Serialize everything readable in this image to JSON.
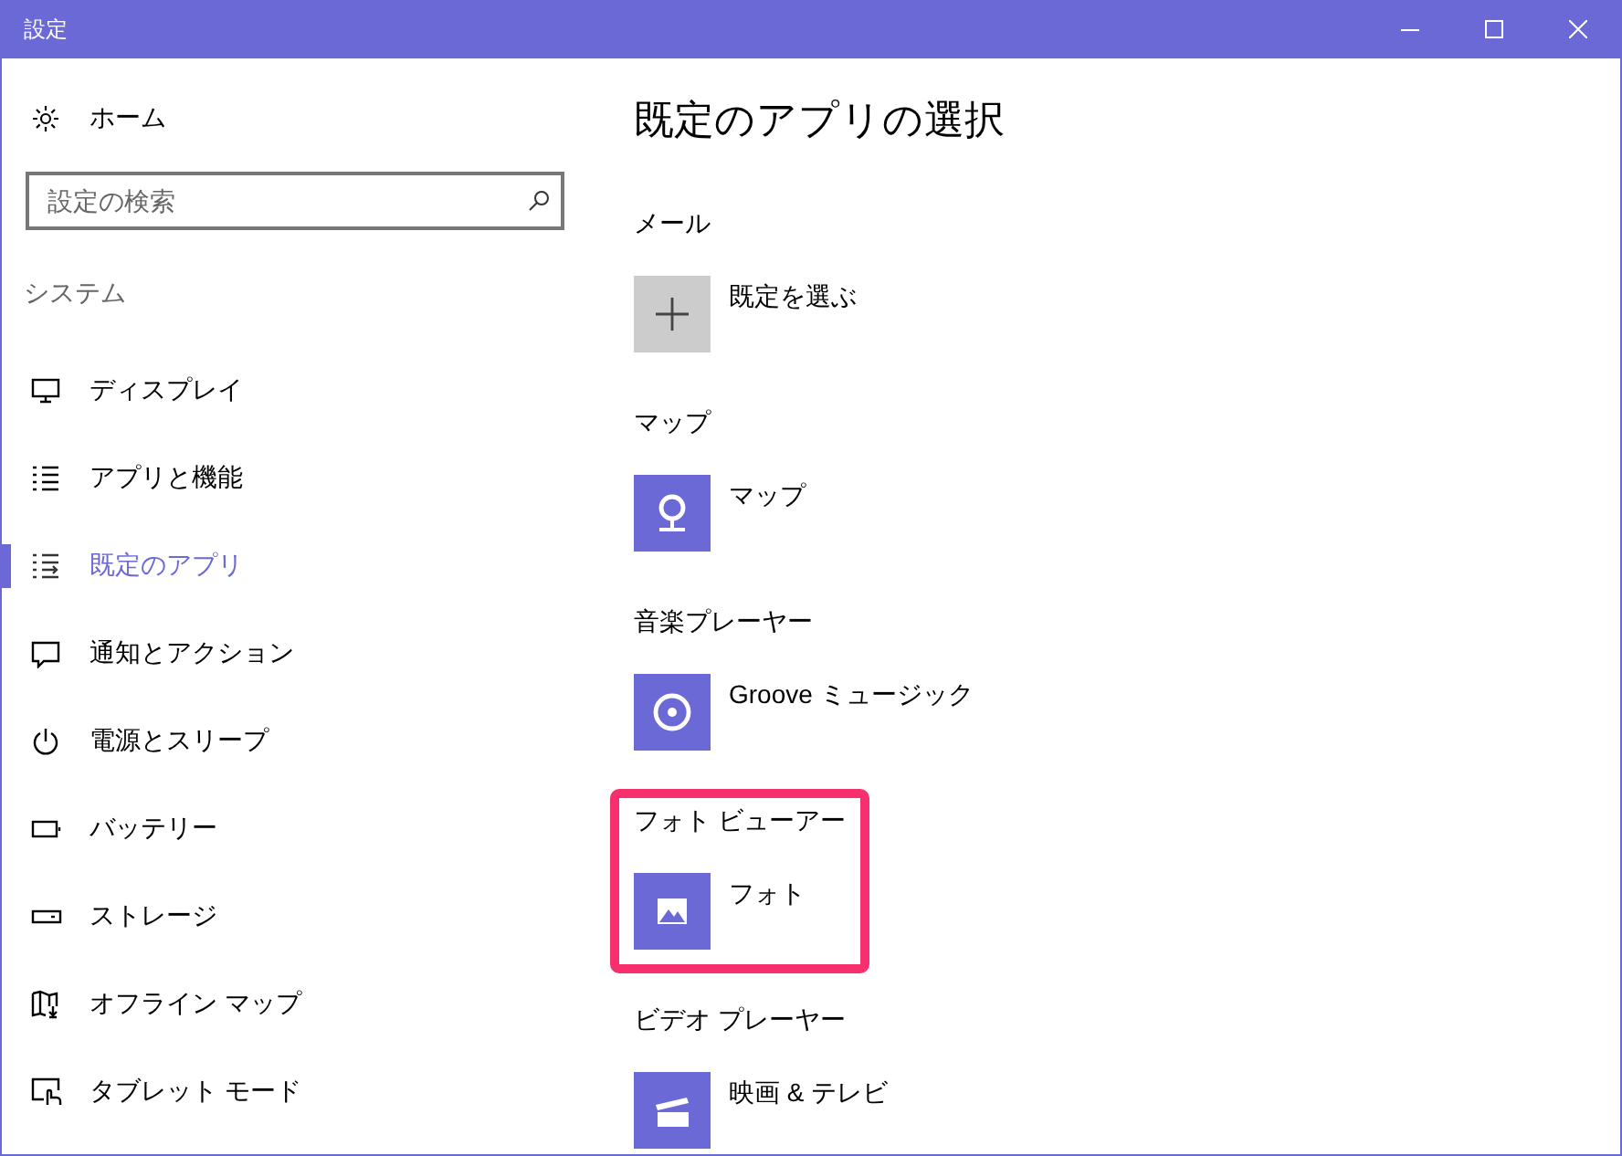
{
  "window": {
    "title": "設定"
  },
  "sidebar": {
    "home": {
      "label": "ホーム"
    },
    "search": {
      "placeholder": "設定の検索"
    },
    "group": "システム",
    "items": [
      {
        "label": "ディスプレイ",
        "kind": "display",
        "selected": false
      },
      {
        "label": "アプリと機能",
        "kind": "apps",
        "selected": false
      },
      {
        "label": "既定のアプリ",
        "kind": "defaults",
        "selected": true
      },
      {
        "label": "通知とアクション",
        "kind": "notify",
        "selected": false
      },
      {
        "label": "電源とスリープ",
        "kind": "power",
        "selected": false
      },
      {
        "label": "バッテリー",
        "kind": "battery",
        "selected": false
      },
      {
        "label": "ストレージ",
        "kind": "storage",
        "selected": false
      },
      {
        "label": "オフライン マップ",
        "kind": "map",
        "selected": false
      },
      {
        "label": "タブレット モード",
        "kind": "tablet",
        "selected": false
      }
    ]
  },
  "content": {
    "heading": "既定のアプリの選択",
    "sections": [
      {
        "label": "メール",
        "app": "既定を選ぶ",
        "kind": "add",
        "highlighted": false
      },
      {
        "label": "マップ",
        "app": "マップ",
        "kind": "maps",
        "highlighted": false
      },
      {
        "label": "音楽プレーヤー",
        "app": "Groove ミュージック",
        "kind": "music",
        "highlighted": false
      },
      {
        "label": "フォト ビューアー",
        "app": "フォト",
        "kind": "photos",
        "highlighted": true
      },
      {
        "label": "ビデオ プレーヤー",
        "app": "映画 & テレビ",
        "kind": "video",
        "highlighted": false
      }
    ]
  }
}
